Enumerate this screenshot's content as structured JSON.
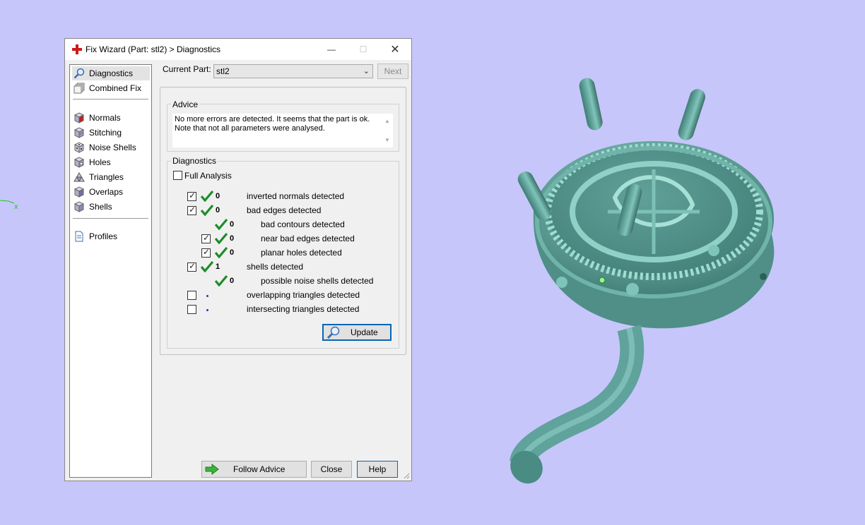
{
  "dialog": {
    "title": "Fix Wizard (Part: stl2) > Diagnostics",
    "window_controls": {
      "minimize": "—",
      "maximize": "☐",
      "close": "✕"
    }
  },
  "sidebar": {
    "items": [
      {
        "label": "Diagnostics",
        "icon": "magnifier-icon",
        "selected": true
      },
      {
        "label": "Combined Fix",
        "icon": "stack-icon"
      },
      {
        "label": "Normals",
        "icon": "normals-cube-icon"
      },
      {
        "label": "Stitching",
        "icon": "stitching-cube-icon"
      },
      {
        "label": "Noise Shells",
        "icon": "noise-shells-icon"
      },
      {
        "label": "Holes",
        "icon": "holes-cube-icon"
      },
      {
        "label": "Triangles",
        "icon": "triangles-icon"
      },
      {
        "label": "Overlaps",
        "icon": "overlaps-cube-icon"
      },
      {
        "label": "Shells",
        "icon": "shells-cube-icon"
      },
      {
        "label": "Profiles",
        "icon": "document-icon"
      }
    ]
  },
  "current_part": {
    "label": "Current Part:",
    "value": "stl2",
    "next_label": "Next"
  },
  "advice": {
    "title": "Advice",
    "text_line1": "No more errors are detected. It seems that the part is ok.",
    "text_line2": "Note that not all parameters were analysed."
  },
  "diagnostics": {
    "title": "Diagnostics",
    "full_analysis_label": "Full Analysis",
    "rows": [
      {
        "label": "inverted normals detected",
        "count": "0",
        "checked": true,
        "status": "ok"
      },
      {
        "label": "bad edges detected",
        "count": "0",
        "checked": true,
        "status": "ok"
      },
      {
        "label": "bad contours detected",
        "count": "0",
        "status": "ok"
      },
      {
        "label": "near bad edges detected",
        "count": "0",
        "checked": true,
        "status": "ok"
      },
      {
        "label": "planar holes detected",
        "count": "0",
        "checked": true,
        "status": "ok"
      },
      {
        "label": "shells detected",
        "count": "1",
        "checked": true,
        "status": "ok"
      },
      {
        "label": "possible noise shells detected",
        "count": "0",
        "status": "ok"
      },
      {
        "label": "overlapping triangles detected",
        "checked": false,
        "status": "not-analysed"
      },
      {
        "label": "intersecting triangles detected",
        "checked": false,
        "status": "not-analysed"
      }
    ],
    "update_label": "Update"
  },
  "buttons": {
    "follow_advice": "Follow Advice",
    "close": "Close",
    "help": "Help"
  },
  "viewport": {
    "axis_label": "x",
    "background": "#c6c6fa",
    "model_color": "#5fa39c"
  },
  "colors": {
    "check_green": "#1e8c28",
    "accent_blue": "#0a64b4"
  }
}
